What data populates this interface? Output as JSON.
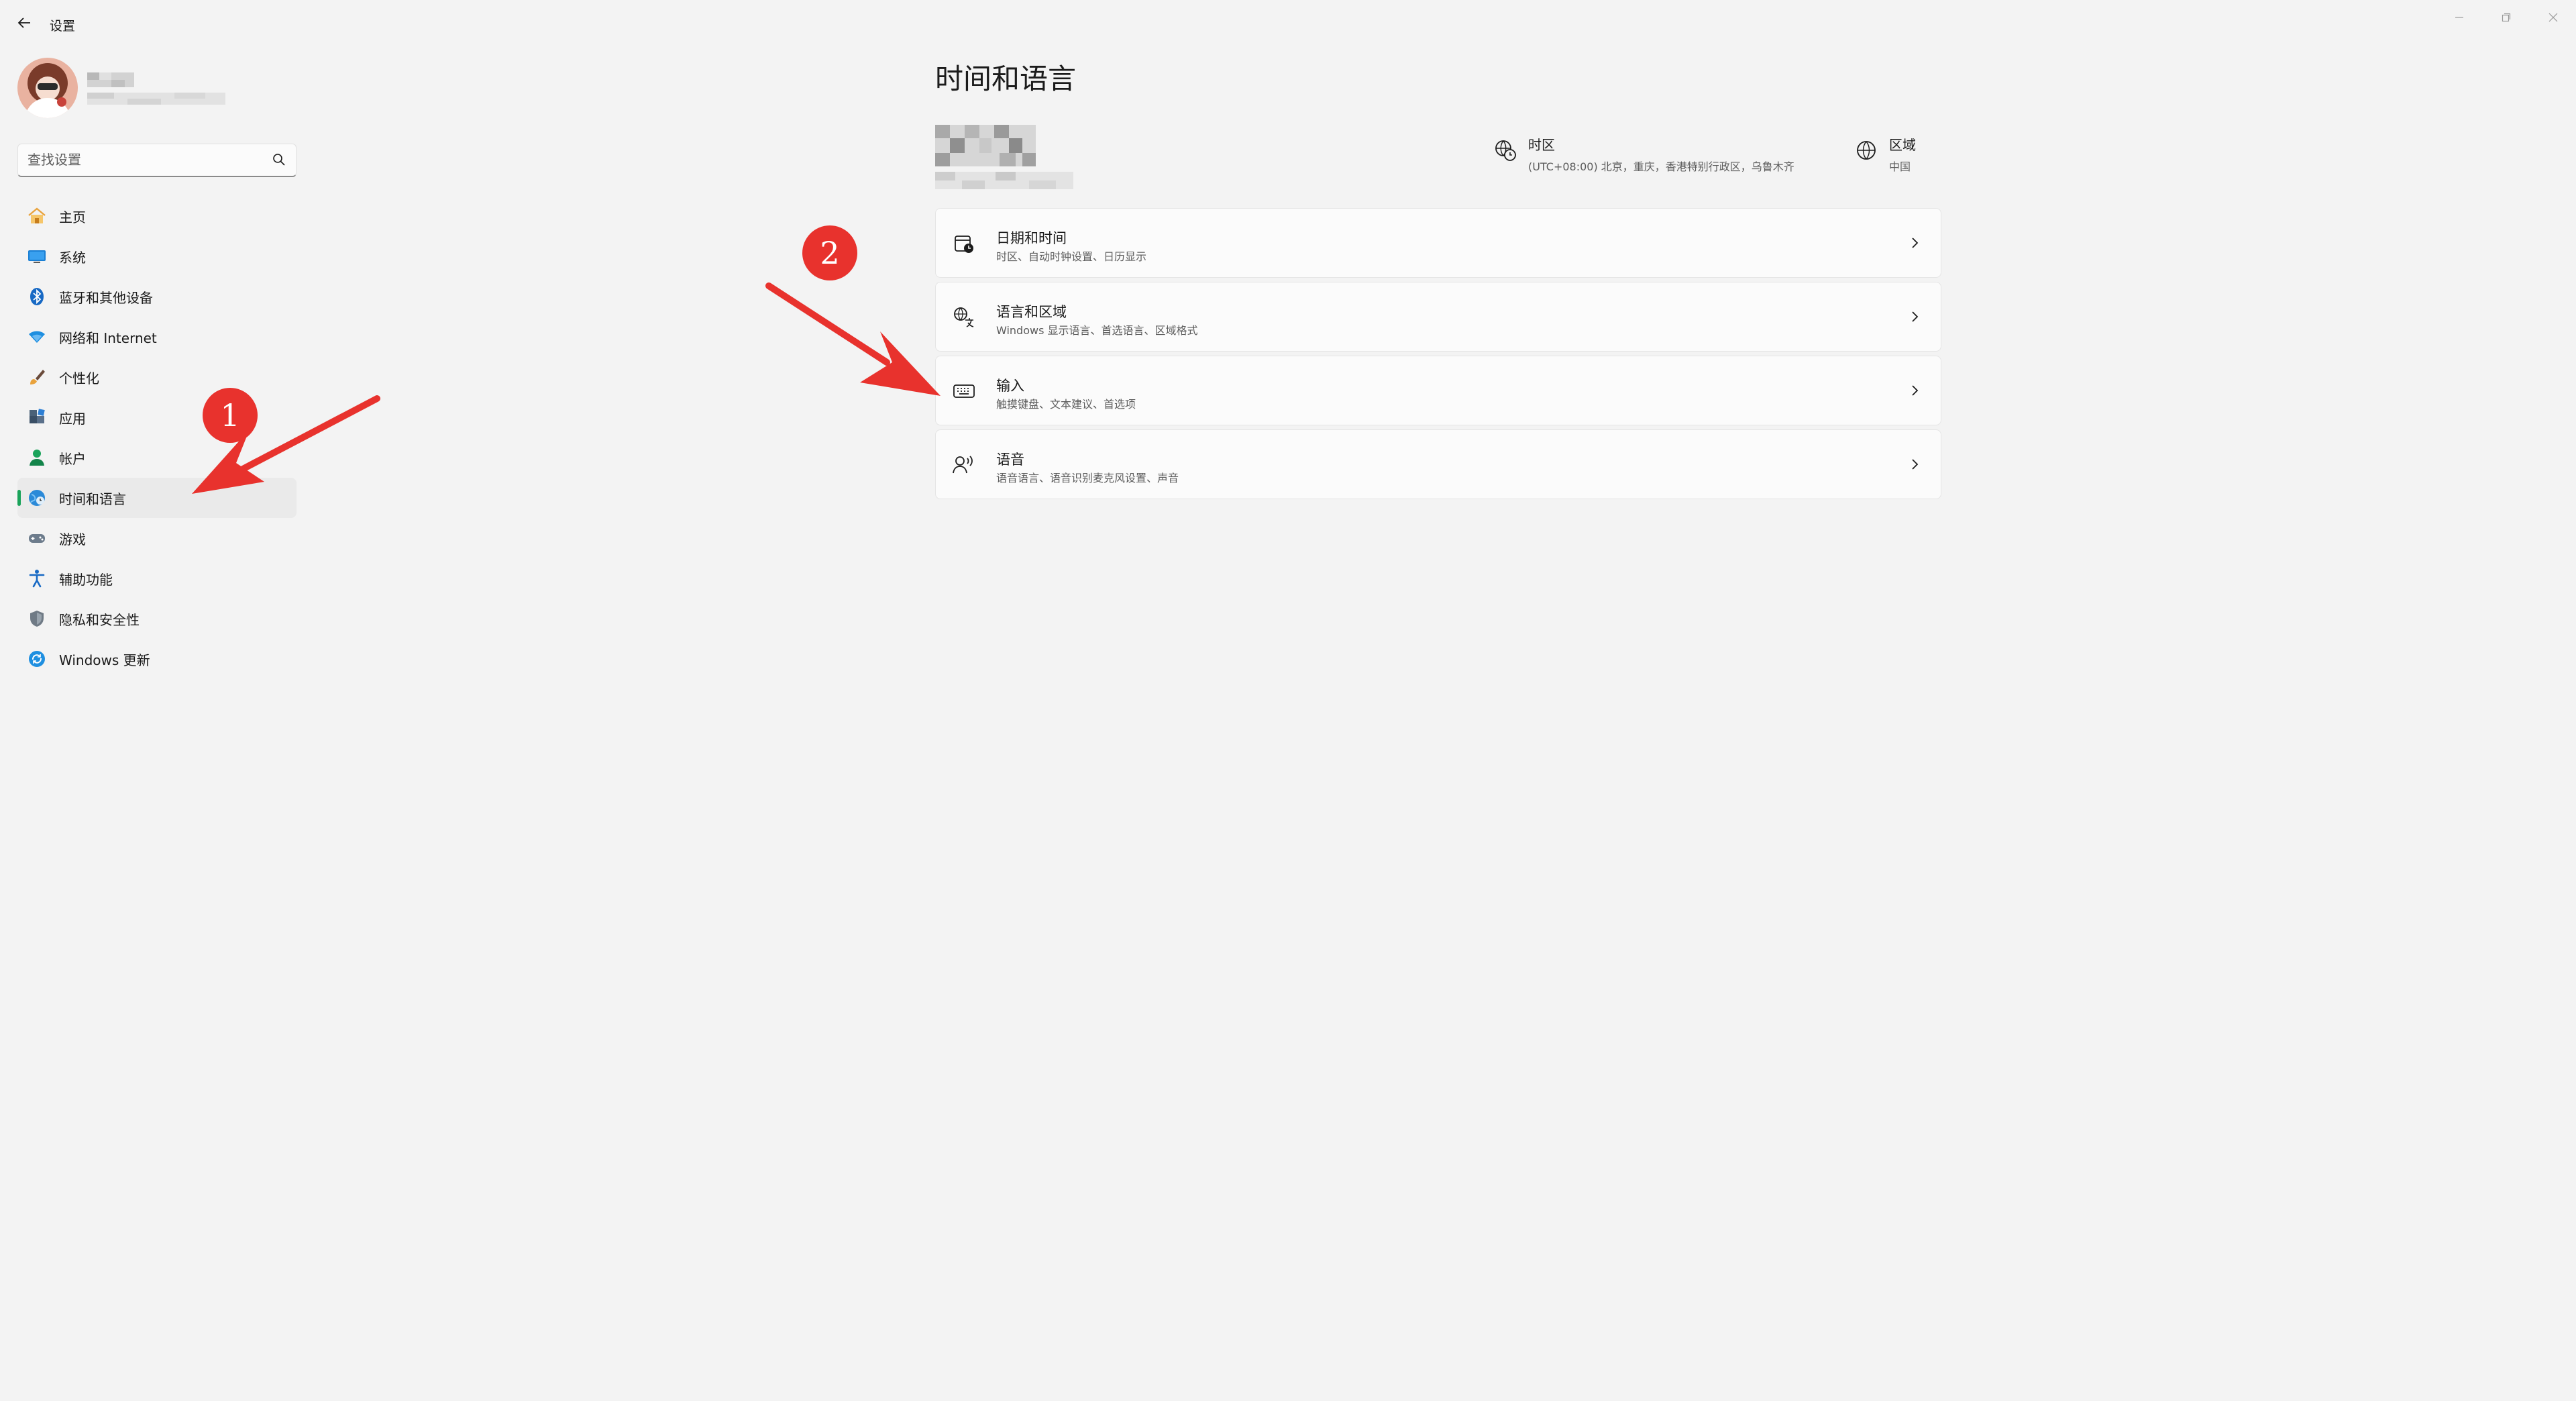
{
  "window": {
    "title": "设置",
    "controls": [
      "minimize-icon",
      "maximize-icon",
      "close-icon"
    ]
  },
  "sidebar": {
    "search_placeholder": "查找设置",
    "items": [
      {
        "label": "主页",
        "icon": "home-icon"
      },
      {
        "label": "系统",
        "icon": "display-icon"
      },
      {
        "label": "蓝牙和其他设备",
        "icon": "bluetooth-icon"
      },
      {
        "label": "网络和 Internet",
        "icon": "wifi-icon"
      },
      {
        "label": "个性化",
        "icon": "brush-icon"
      },
      {
        "label": "应用",
        "icon": "apps-icon"
      },
      {
        "label": "帐户",
        "icon": "account-icon"
      },
      {
        "label": "时间和语言",
        "icon": "globe-clock-icon",
        "active": true
      },
      {
        "label": "游戏",
        "icon": "gamepad-icon"
      },
      {
        "label": "辅助功能",
        "icon": "accessibility-icon"
      },
      {
        "label": "隐私和安全性",
        "icon": "shield-icon"
      },
      {
        "label": "Windows 更新",
        "icon": "update-icon"
      }
    ]
  },
  "main": {
    "page_title": "时间和语言",
    "timezone": {
      "title": "时区",
      "value": "(UTC+08:00) 北京，重庆，香港特别行政区，乌鲁木齐"
    },
    "region": {
      "title": "区域",
      "value": "中国"
    },
    "cards": [
      {
        "title": "日期和时间",
        "subtitle": "时区、自动时钟设置、日历显示",
        "icon": "calendar-clock-icon"
      },
      {
        "title": "语言和区域",
        "subtitle": "Windows 显示语言、首选语言、区域格式",
        "icon": "language-icon"
      },
      {
        "title": "输入",
        "subtitle": "触摸键盘、文本建议、首选项",
        "icon": "keyboard-icon"
      },
      {
        "title": "语音",
        "subtitle": "语音语言、语音识别麦克风设置、声音",
        "icon": "speech-icon"
      }
    ]
  },
  "annotations": {
    "badge_1": "1",
    "badge_2": "2",
    "color": "#e8322d"
  },
  "colors": {
    "accent": "#1aa35a",
    "background": "#f3f3f3",
    "card": "#fbfbfb"
  }
}
